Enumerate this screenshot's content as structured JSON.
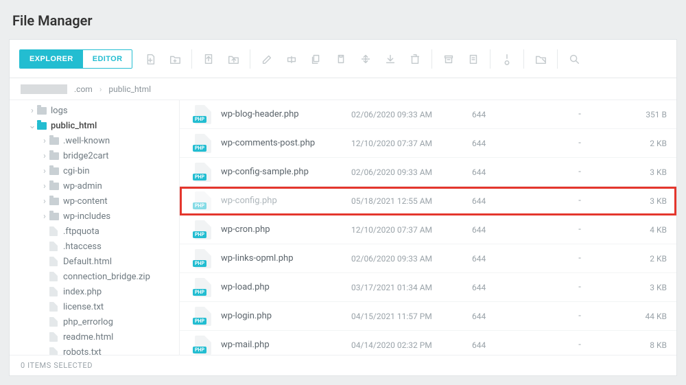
{
  "title": "File Manager",
  "tabs": {
    "explorer": "EXPLORER",
    "editor": "EDITOR",
    "active": "explorer"
  },
  "breadcrumbs": {
    "domain_visible_suffix": ".com",
    "folder": "public_html"
  },
  "tree": {
    "root": [
      {
        "type": "folder",
        "label": "logs",
        "depth": 1,
        "expandable": true,
        "open": false
      },
      {
        "type": "folder",
        "label": "public_html",
        "depth": 1,
        "expandable": true,
        "open": true,
        "selected": true,
        "color": "open",
        "children": [
          {
            "type": "folder",
            "label": ".well-known",
            "depth": 2,
            "expandable": true
          },
          {
            "type": "folder",
            "label": "bridge2cart",
            "depth": 2,
            "expandable": true
          },
          {
            "type": "folder",
            "label": "cgi-bin",
            "depth": 2,
            "expandable": true
          },
          {
            "type": "folder",
            "label": "wp-admin",
            "depth": 2,
            "expandable": true
          },
          {
            "type": "folder",
            "label": "wp-content",
            "depth": 2,
            "expandable": true
          },
          {
            "type": "folder",
            "label": "wp-includes",
            "depth": 2,
            "expandable": true
          },
          {
            "type": "file",
            "label": ".ftpquota",
            "depth": 2
          },
          {
            "type": "file",
            "label": ".htaccess",
            "depth": 2
          },
          {
            "type": "file",
            "label": "Default.html",
            "depth": 2
          },
          {
            "type": "file",
            "label": "connection_bridge.zip",
            "depth": 2
          },
          {
            "type": "file",
            "label": "index.php",
            "depth": 2
          },
          {
            "type": "file",
            "label": "license.txt",
            "depth": 2
          },
          {
            "type": "file",
            "label": "php_errorlog",
            "depth": 2
          },
          {
            "type": "file",
            "label": "readme.html",
            "depth": 2
          },
          {
            "type": "file",
            "label": "robots.txt",
            "depth": 2
          }
        ]
      }
    ]
  },
  "files": [
    {
      "name": "wp-blog-header.php",
      "date": "02/06/2020 09:33 AM",
      "perm": "644",
      "owner": "-",
      "size": "351 B",
      "ext": "PHP"
    },
    {
      "name": "wp-comments-post.php",
      "date": "12/10/2020 07:37 AM",
      "perm": "644",
      "owner": "-",
      "size": "2 KB",
      "ext": "PHP"
    },
    {
      "name": "wp-config-sample.php",
      "date": "02/06/2020 09:33 AM",
      "perm": "644",
      "owner": "-",
      "size": "3 KB",
      "ext": "PHP"
    },
    {
      "name": "wp-config.php",
      "date": "05/18/2021 12:55 AM",
      "perm": "644",
      "owner": "-",
      "size": "3 KB",
      "ext": "PHP",
      "highlight": true,
      "dim": true
    },
    {
      "name": "wp-cron.php",
      "date": "12/10/2020 07:37 AM",
      "perm": "644",
      "owner": "-",
      "size": "4 KB",
      "ext": "PHP"
    },
    {
      "name": "wp-links-opml.php",
      "date": "02/06/2020 09:33 AM",
      "perm": "644",
      "owner": "-",
      "size": "2 KB",
      "ext": "PHP"
    },
    {
      "name": "wp-load.php",
      "date": "03/17/2021 01:34 AM",
      "perm": "644",
      "owner": "-",
      "size": "3 KB",
      "ext": "PHP"
    },
    {
      "name": "wp-login.php",
      "date": "04/15/2021 11:57 PM",
      "perm": "644",
      "owner": "-",
      "size": "44 KB",
      "ext": "PHP"
    },
    {
      "name": "wp-mail.php",
      "date": "04/14/2020 02:32 PM",
      "perm": "644",
      "owner": "-",
      "size": "8 KB",
      "ext": "PHP",
      "partial": true
    }
  ],
  "status": "0 ITEMS SELECTED",
  "toolbar_icons": [
    "new-file-icon",
    "new-folder-icon",
    "sep",
    "upload-icon",
    "upload-folder-icon",
    "sep",
    "edit-icon",
    "rename-icon",
    "copy-icon",
    "paste-icon",
    "move-icon",
    "download-icon",
    "delete-icon",
    "sep",
    "archive-icon",
    "extract-icon",
    "sep",
    "permissions-icon",
    "sep",
    "view-icon",
    "sep",
    "search-icon"
  ]
}
